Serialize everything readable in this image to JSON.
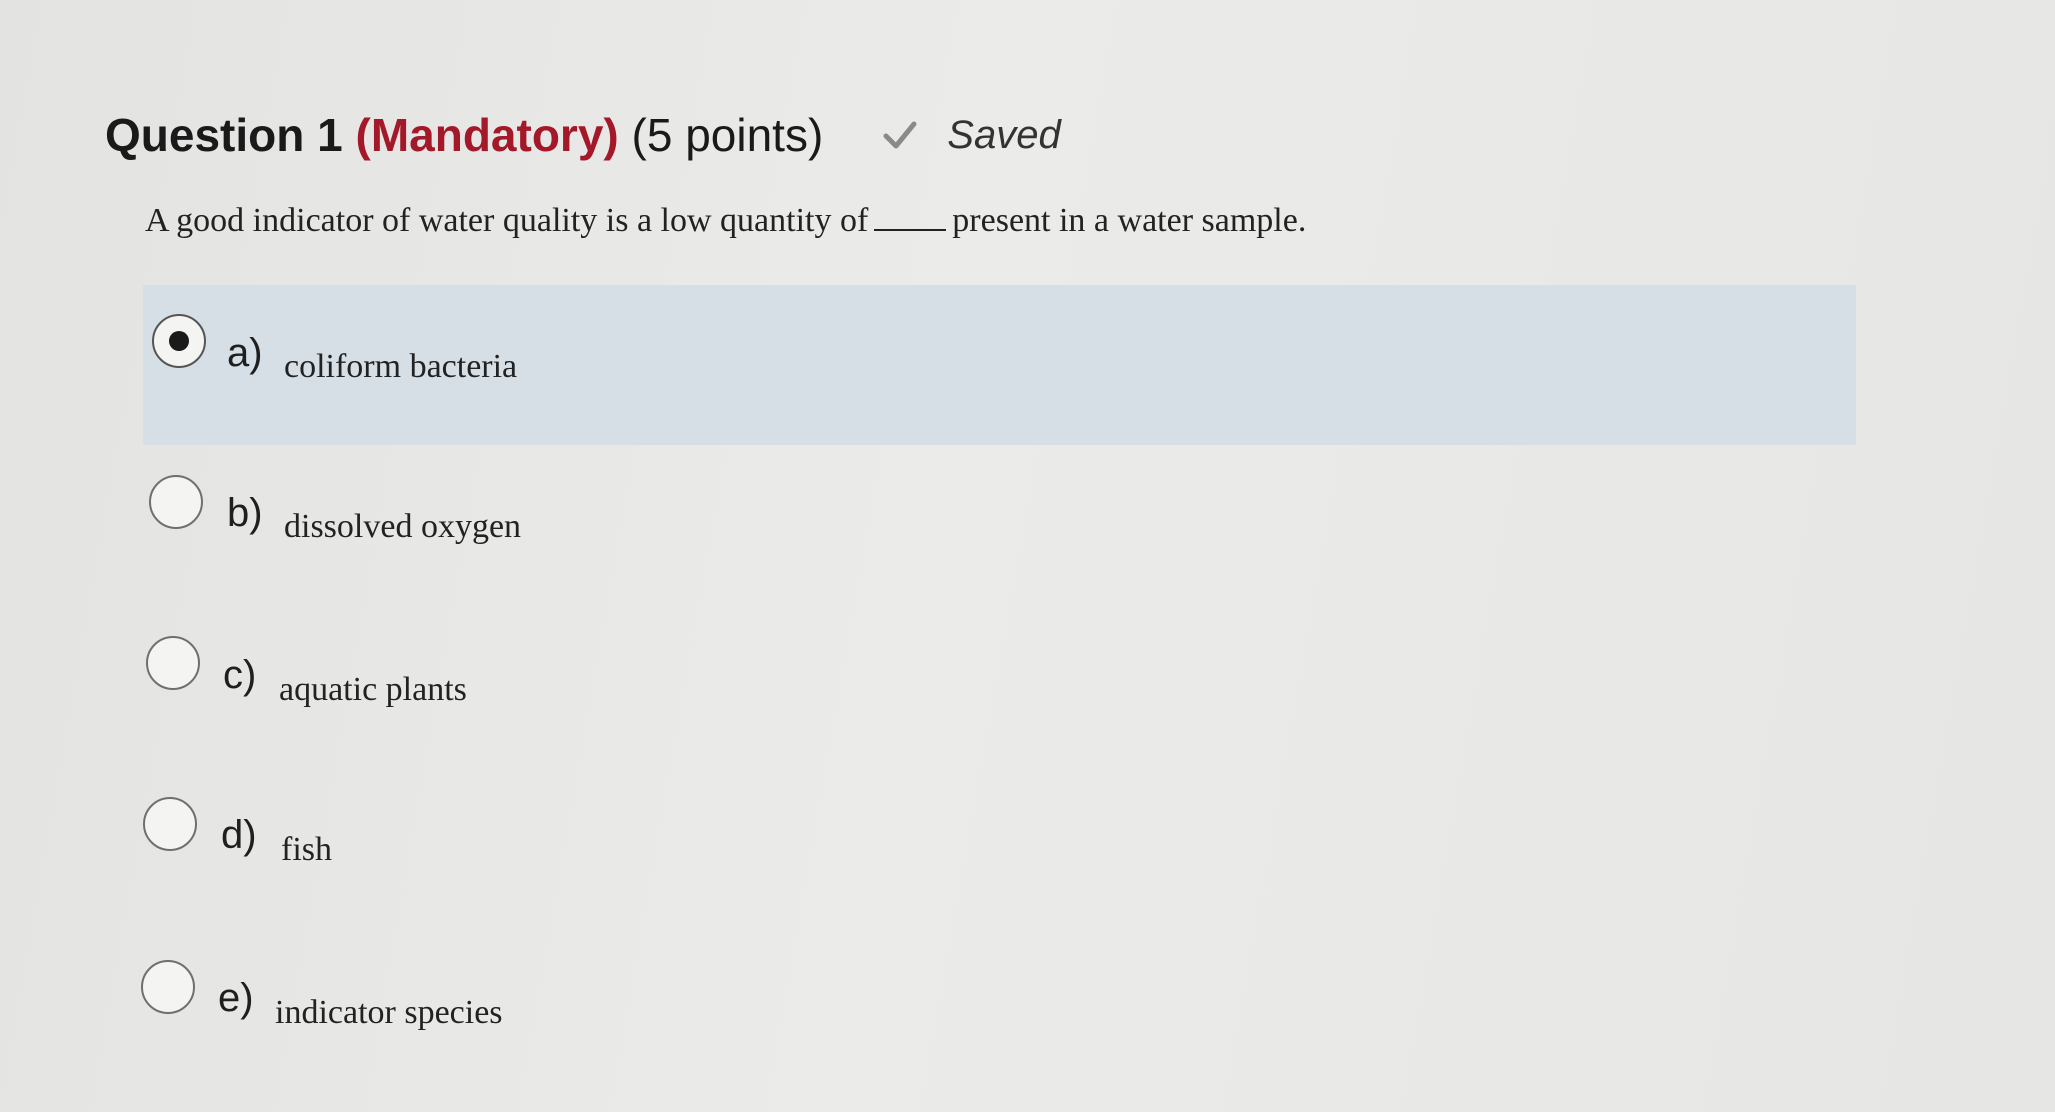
{
  "question": {
    "number_label": "Question 1",
    "mandatory_label": "(Mandatory)",
    "points_label": "(5 points)",
    "status_icon": "check-icon",
    "status_label": "Saved",
    "prompt_before": "A good indicator of water quality is a low quantity of",
    "prompt_after": "present in a water sample.",
    "accent_color": "#a3192a",
    "selected_bg_color": "#d6dfe5",
    "selected_option": "a)"
  },
  "options": [
    {
      "letter": "a)",
      "text": "coliform bacteria",
      "selected": true
    },
    {
      "letter": "b)",
      "text": "dissolved oxygen",
      "selected": false
    },
    {
      "letter": "c)",
      "text": "aquatic plants",
      "selected": false
    },
    {
      "letter": "d)",
      "text": "fish",
      "selected": false
    },
    {
      "letter": "e)",
      "text": "indicator species",
      "selected": false
    }
  ]
}
